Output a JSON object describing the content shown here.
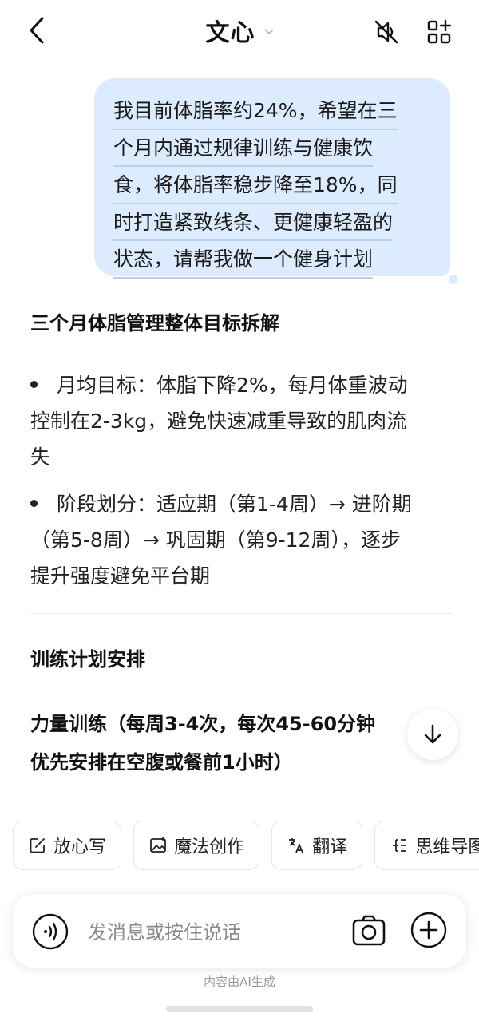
{
  "header": {
    "title": "文心",
    "back_icon": "chevron-left-icon",
    "title_dropdown_icon": "chevron-down-icon",
    "mute_icon": "speaker-muted-icon",
    "apps_icon": "apps-grid-icon"
  },
  "user_message": {
    "lines": [
      "我目前体脂率约24%，希望在三",
      "个月内通过规律训练与健康饮",
      "食，将体脂率稳步降至18%，同",
      "时打造紧致线条、更健康轻盈的",
      "状态，请帮我做一个健身计划"
    ]
  },
  "answer": {
    "heading1": "三个月体脂管理整体目标拆解",
    "bullets": [
      {
        "lines": [
          "月均目标：体脂下降2%，每月体重波动",
          "控制在2-3kg，避免快速减重导致的肌肉流",
          "失"
        ]
      },
      {
        "lines": [
          "阶段划分：适应期（第1-4周）→ 进阶期",
          "（第5-8周）→ 巩固期（第9-12周），逐步",
          "提升强度避免平台期"
        ]
      }
    ],
    "heading2": "训练计划安排",
    "bold_para": {
      "lines": [
        "力量训练（每周3-4次，每次45-60分钟",
        "优先安排在空腹或餐前1小时）"
      ]
    }
  },
  "scroll_down_icon": "arrow-down-icon",
  "chips": [
    {
      "label": "放心写",
      "icon": "edit-icon"
    },
    {
      "label": "魔法创作",
      "icon": "image-magic-icon"
    },
    {
      "label": "翻译",
      "icon": "translate-icon"
    },
    {
      "label": "思维导图",
      "icon": "mind-map-icon"
    }
  ],
  "input": {
    "placeholder": "发消息或按住说话",
    "voice_icon": "voice-wave-icon",
    "camera_icon": "camera-icon",
    "plus_icon": "plus-icon"
  },
  "footer_note": "内容由AI生成",
  "colors": {
    "bubble": "#dcebfd",
    "text": "#1a1a1a",
    "placeholder": "#8a8a8a"
  }
}
